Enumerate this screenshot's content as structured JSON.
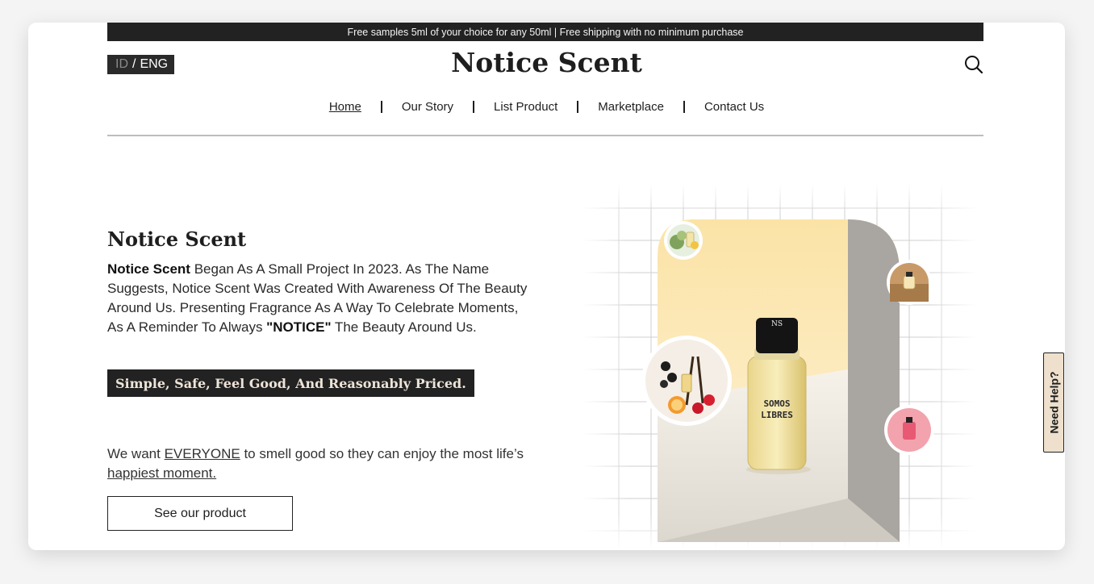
{
  "announcement": "Free samples 5ml of your choice for any 50ml | Free shipping with no minimum purchase",
  "language": {
    "inactive": "ID",
    "separator": "/",
    "active": "ENG"
  },
  "brand": "Notice Scent",
  "nav": {
    "items": [
      {
        "label": "Home"
      },
      {
        "label": "Our Story"
      },
      {
        "label": "List Product"
      },
      {
        "label": "Marketplace"
      },
      {
        "label": "Contact Us"
      }
    ]
  },
  "intro": {
    "title": "Notice Scent",
    "text_bold": "Notice Scent",
    "text_1": " Began As A Small Project In 2023. As The Name Suggests, Notice Scent Was Created With Awareness Of The Beauty Around Us. Presenting Fragrance As A Way To Celebrate Moments, As A Reminder To Always ",
    "text_emph": "\"NOTICE\"",
    "text_2": " The Beauty Around Us.",
    "tagline": "Simple, Safe, Feel Good, And Reasonably Priced."
  },
  "mission": {
    "text_1": "We want ",
    "emph_1": "EVERYONE",
    "text_2": " to smell good so they can enjoy the most life’s ",
    "emph_2": "happiest moment."
  },
  "cta": {
    "label": "See our product"
  },
  "product": {
    "bottle_line1": "SOMOS",
    "bottle_line2": "LIBRES",
    "cap_mark": "NS"
  },
  "help": {
    "label": "Need Help?"
  },
  "colors": {
    "dark": "#222222",
    "tagline_text": "#eee4d8",
    "help_bg": "#eee0cc"
  }
}
